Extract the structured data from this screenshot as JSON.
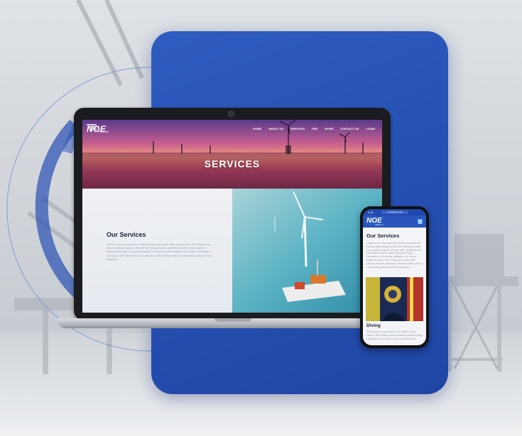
{
  "brand": {
    "logo_text": "NOE",
    "logo_subtext": "Offshore",
    "accent_color": "#2650b3"
  },
  "laptop": {
    "nav_items": [
      "HOME",
      "ABOUT US",
      "SERVICES",
      "HSE",
      "NEWS",
      "CONTACT US",
      "LOGIN"
    ],
    "hero_title": "SERVICES",
    "section_heading": "Our Services",
    "section_text": "Thanks to our long experience of different subsea and topside offshore assignments, NOE Offshore can take on a variety of projects. We offer Safe, Quality Assured and Efficient services within Inspection, Repair, Maintenance, Survey and Installation. Our service portfolio includes: ROV, Diving, Heat Bundle and Survey. NOE Offshore provides customized, flexible solutions without compromising safety and client satisfaction."
  },
  "phone": {
    "status_time": "9:32",
    "url": "noeoffshore.com",
    "section_heading": "Our Services",
    "section_text": "Thanks to our long experience of different subsea and topside offshore assignments, NOE Offshore can take on a variety of projects. We offer Safe, Quality Assured and Efficient services within Inspection, Repair, Maintenance, Survey and Installation. Our service portfolio includes: ROV, Diving and Survey. NOE Offshore provides customized, flexible solutions without compromising safety and client satisfaction.",
    "subsection_heading": "Diving",
    "subsection_text": "With decades of experience in the offshore diving industry, NOE Offshore delivers safe and efficient diving operations for inspection, repair and maintenance."
  }
}
